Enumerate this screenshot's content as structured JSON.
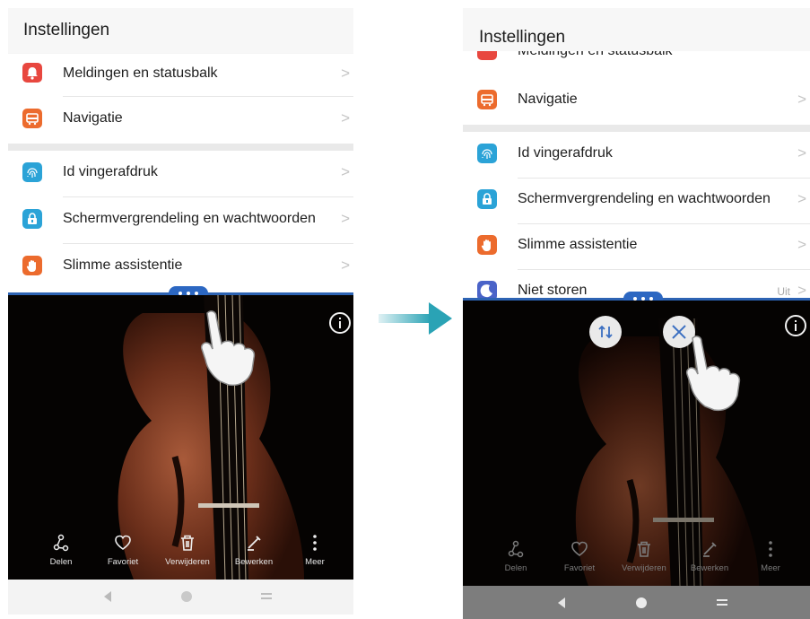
{
  "left": {
    "title": "Instellingen",
    "items": [
      {
        "label": "Meldingen en statusbalk",
        "icon": "bell-icon",
        "color": "#e8473f"
      },
      {
        "label": "Navigatie",
        "icon": "navigation-icon",
        "color": "#ec6b2d"
      },
      {
        "label": "Id vingerafdruk",
        "icon": "fingerprint-icon",
        "color": "#2ba3d7"
      },
      {
        "label": "Schermvergrendeling en wachtwoorden",
        "icon": "lock-icon",
        "color": "#2ba3d7"
      },
      {
        "label": "Slimme assistentie",
        "icon": "hand-icon",
        "color": "#ec6b2d"
      }
    ],
    "toolbar": [
      {
        "label": "Delen",
        "icon": "share-icon"
      },
      {
        "label": "Favoriet",
        "icon": "heart-icon"
      },
      {
        "label": "Verwijderen",
        "icon": "trash-icon"
      },
      {
        "label": "Bewerken",
        "icon": "edit-icon"
      },
      {
        "label": "Meer",
        "icon": "more-icon"
      }
    ]
  },
  "right": {
    "title": "Instellingen",
    "partial_item": {
      "label": "Meldingen en statusbalk"
    },
    "items": [
      {
        "label": "Navigatie",
        "icon": "navigation-icon",
        "color": "#ec6b2d"
      },
      {
        "label": "Id vingerafdruk",
        "icon": "fingerprint-icon",
        "color": "#2ba3d7"
      },
      {
        "label": "Schermvergrendeling en wachtwoorden",
        "icon": "lock-icon",
        "color": "#2ba3d7"
      },
      {
        "label": "Slimme assistentie",
        "icon": "hand-icon",
        "color": "#ec6b2d"
      },
      {
        "label": "Niet storen",
        "icon": "moon-icon",
        "color": "#4a63c8",
        "value": "Uit"
      }
    ],
    "toolbar": [
      {
        "label": "Delen",
        "icon": "share-icon"
      },
      {
        "label": "Favoriet",
        "icon": "heart-icon"
      },
      {
        "label": "Verwijderen",
        "icon": "trash-icon"
      },
      {
        "label": "Bewerken",
        "icon": "edit-icon"
      },
      {
        "label": "Meer",
        "icon": "more-icon"
      }
    ]
  },
  "colors": {
    "split_accent": "#2c67c2",
    "arrow": "#2aa3b5"
  }
}
